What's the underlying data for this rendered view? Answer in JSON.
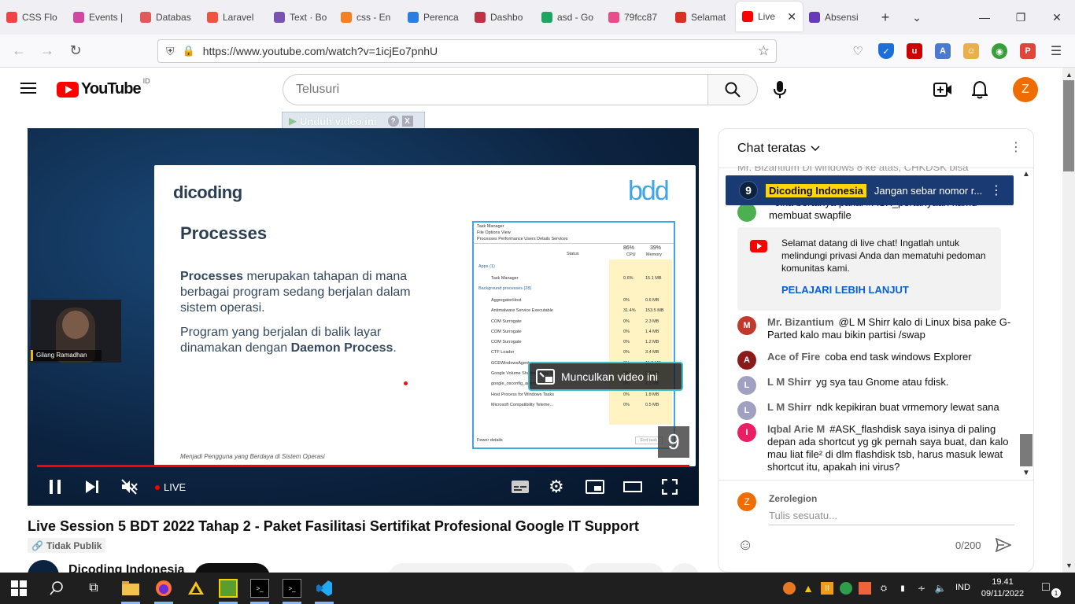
{
  "browser": {
    "tabs": [
      {
        "label": "CSS Flo",
        "color": "#e44"
      },
      {
        "label": "Events |",
        "color": "#d048a0"
      },
      {
        "label": "Databas",
        "color": "#e05a5a"
      },
      {
        "label": "Laravel",
        "color": "#f05340"
      },
      {
        "label": "Text · Bo",
        "color": "#7952b3"
      },
      {
        "label": "css - En",
        "color": "#f48024"
      },
      {
        "label": "Perenca",
        "color": "#2a7de1"
      },
      {
        "label": "Dashbo",
        "color": "#b34"
      },
      {
        "label": "asd - Go",
        "color": "#1fa463"
      },
      {
        "label": "79fcc87",
        "color": "#ea4c89"
      },
      {
        "label": "Selamat",
        "color": "#d93025"
      },
      {
        "label": "Live",
        "color": "#f00"
      },
      {
        "label": "Absensi",
        "color": "#673ab7"
      }
    ],
    "new_tab": "+",
    "tab_list": "⌄",
    "url": "https://www.youtube.com/watch?v=1icjEo7pnhU"
  },
  "yt": {
    "country": "ID",
    "search_placeholder": "Telusuri",
    "avatar_letter": "Z",
    "download_helper": "Unduh video ini",
    "download_q": "?",
    "download_x": "X"
  },
  "video": {
    "slide_logo": "dicoding",
    "slide_logo2": "bdd",
    "slide_title": "Processes",
    "slide_p1a": "Processes",
    "slide_p1b": " merupakan tahapan di mana berbagai program sedang berjalan dalam sistem operasi.",
    "slide_p2a": "Program yang berjalan di balik layar dinamakan dengan ",
    "slide_p2b": "Daemon Process",
    "slide_p2c": ".",
    "slide_footer": "Menjadi Pengguna yang Berdaya di Sistem Operasi",
    "speaker": "Gilang Ramadhan",
    "tm_title": "Task Manager",
    "tm_menu": "File   Options   View",
    "tm_tabs": "Processes  Performance  Users  Details  Services",
    "tm_cpu": "86%",
    "tm_mem": "39%",
    "tm_cpu_label": "CPU",
    "tm_mem_label": "Memory",
    "tm_status": "Status",
    "tm_apps": "Apps (1)",
    "tm_bg": "Background processes (28)",
    "tm_rows": [
      {
        "name": "Task Manager",
        "cpu": "0.6%",
        "mem": "15.1 MB"
      },
      {
        "name": "AggregatorHost",
        "cpu": "0%",
        "mem": "0.6 MB"
      },
      {
        "name": "Antimalware Service Executable",
        "cpu": "31.4%",
        "mem": "153.5 MB"
      },
      {
        "name": "COM Surrogate",
        "cpu": "0%",
        "mem": "2.3 MB"
      },
      {
        "name": "COM Surrogate",
        "cpu": "0%",
        "mem": "1.4 MB"
      },
      {
        "name": "COM Surrogate",
        "cpu": "0%",
        "mem": "1.2 MB"
      },
      {
        "name": "CTF Loader",
        "cpu": "0%",
        "mem": "3.4 MB"
      },
      {
        "name": "GCEWindowsAgent",
        "cpu": "0%",
        "mem": "11.2 MB"
      },
      {
        "name": "Google Volume Shadow Copy S...",
        "cpu": "0%",
        "mem": "0.3 MB"
      },
      {
        "name": "google_osconfig_agent",
        "cpu": "0%",
        "mem": "7.1 MB"
      },
      {
        "name": "Host Process for Windows Tasks",
        "cpu": "0%",
        "mem": "1.8 MB"
      },
      {
        "name": "Microsoft Compatibility Teleme...",
        "cpu": "0%",
        "mem": "0.5 MB"
      }
    ],
    "tm_fewer": "Fewer details",
    "tm_end": "End task",
    "pip_button": "Munculkan video ini",
    "watermark": "9",
    "live_label": "LIVE",
    "progress": 1.0
  },
  "meta": {
    "title": "Live Session 5 BDT 2022 Tahap 2 - Paket Fasilitasi Sertifikat Profesional Google IT Support",
    "visibility": "Tidak Publik",
    "channel": "Dicoding Indonesia"
  },
  "chat": {
    "header": "Chat teratas",
    "pinned_author": "Dicoding Indonesia",
    "pinned_text": "Jangan sebar nomor r...",
    "ghost_top": "Mr. Bizantium   Di windows 8 ke atas, CHKDSK bisa",
    "ghost_line2": "- Jika bertanya pakai #ASK_pertanyaan kamu",
    "ghost_line3": "membuat swapfile",
    "welcome": "Selamat datang di live chat! Ingatlah untuk melindungi privasi Anda dan mematuhi pedoman komunitas kami.",
    "learn_more": "PELAJARI LEBIH LANJUT",
    "messages": [
      {
        "author": "Mr. Bizantium",
        "text": "@L M Shirr kalo di Linux bisa pake G-Parted kalo mau bikin partisi /swap",
        "color": "#c0392b",
        "letter": "M"
      },
      {
        "author": "Ace of Fire",
        "text": "coba end task windows Explorer",
        "color": "#8b1a1a",
        "letter": "A"
      },
      {
        "author": "L M Shirr",
        "text": "yg sya tau Gnome atau fdisk.",
        "color": "#a0a0c0",
        "letter": "L"
      },
      {
        "author": "L M Shirr",
        "text": "ndk kepikiran buat vrmemory lewat sana",
        "color": "#a0a0c0",
        "letter": "L"
      },
      {
        "author": "Iqbal Arie M",
        "text": "#ASK_flashdisk saya isinya di paling depan ada shortcut yg gk pernah saya buat, dan kalo mau liat file² di dlm flashdisk tsb, harus masuk lewat shortcut itu, apakah ini virus?",
        "color": "#e91e63",
        "letter": "I"
      }
    ],
    "me_name": "Zerolegion",
    "me_letter": "Z",
    "input_placeholder": "Tulis sesuatu...",
    "counter": "0/200"
  },
  "taskbar": {
    "lang": "IND",
    "time": "19.41",
    "date": "09/11/2022",
    "notif": "1"
  }
}
